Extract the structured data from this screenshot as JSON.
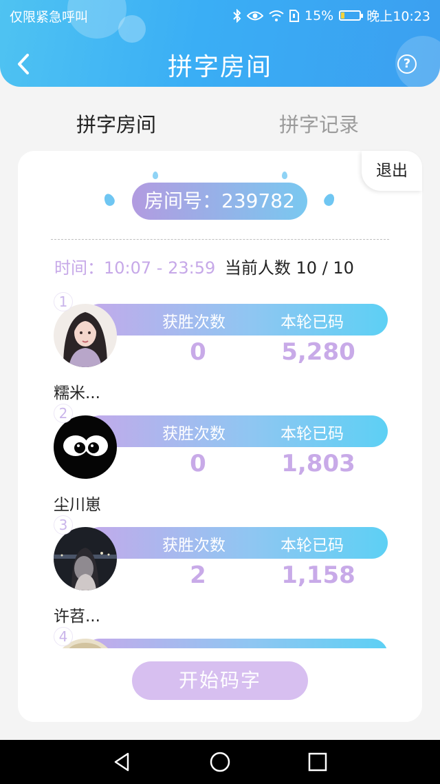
{
  "status_bar": {
    "carrier": "仅限紧急呼叫",
    "battery_percent": "15%",
    "time": "晚上10:23"
  },
  "header": {
    "title": "拼字房间",
    "help_symbol": "?"
  },
  "tabs": [
    {
      "label": "拼字房间",
      "active": true
    },
    {
      "label": "拼字记录",
      "active": false
    }
  ],
  "room": {
    "exit_label": "退出",
    "room_number_text": "房间号：239782",
    "time_label": "时间：",
    "time_range": "10:07 - 23:59",
    "count_label": "当前人数",
    "count_value": "10 / 10"
  },
  "stat_labels": {
    "wins": "获胜次数",
    "chars": "本轮已码"
  },
  "players": [
    {
      "rank": "1",
      "name": "糯米...",
      "wins": "0",
      "chars": "5,280",
      "avatar": "girl-portrait-avatar"
    },
    {
      "rank": "2",
      "name": "尘川崽",
      "wins": "0",
      "chars": "1,803",
      "avatar": "cartoon-eyes-avatar"
    },
    {
      "rank": "3",
      "name": "许苕...",
      "wins": "2",
      "chars": "1,158",
      "avatar": "night-photo-avatar"
    },
    {
      "rank": "4",
      "name": "",
      "wins": "",
      "chars": "",
      "avatar": "partial-avatar"
    }
  ],
  "start_button": "开始码字",
  "colors": {
    "header_blue": "#3aaef5",
    "accent_purple": "#c8aae8",
    "start_button": "#d7bff0"
  }
}
